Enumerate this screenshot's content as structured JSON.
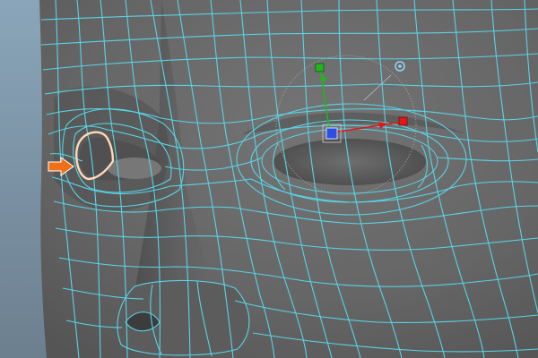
{
  "viewport": {
    "scene": "face-mesh-wireframe",
    "background_color": "#7e98ad",
    "surface_color": "#6a6a6a",
    "wireframe_color": "#59d4e6",
    "selection_highlight_color": "#ffd8b8",
    "pointer_arrow_color": "#f07018"
  },
  "manipulator": {
    "tool": "move-tool",
    "y_axis_color": "#22b422",
    "x_axis_color": "#e01818",
    "pivot_color": "#2d4fe0",
    "rotate_handle_color": "#8fd8f0"
  },
  "icons": {
    "pointer": "orange-arrow-icon",
    "pivot": "pivot-square-icon",
    "y_handle": "green-y-axis-handle-icon",
    "x_handle": "red-x-axis-handle-icon",
    "rotate_handle": "rotate-circle-handle-icon"
  }
}
